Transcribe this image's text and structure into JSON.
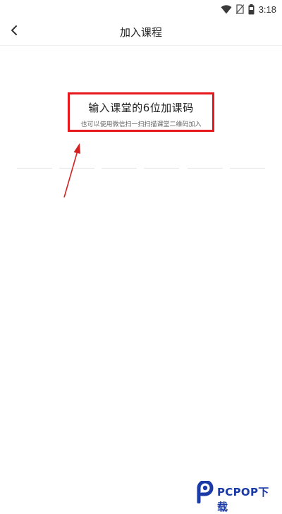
{
  "status_bar": {
    "time": "3:18",
    "icons": [
      "wifi-icon",
      "no-sim-icon",
      "battery-icon"
    ]
  },
  "header": {
    "back_icon": "chevron-left-icon",
    "title": "加入课程"
  },
  "join": {
    "title": "输入课堂的6位加课码",
    "hint": "也可以使用微信扫一扫扫描课堂二维码加入",
    "code_length": 6,
    "code_values": [
      "",
      "",
      "",
      "",
      "",
      ""
    ]
  },
  "watermark": {
    "text": "PCPOP下载"
  },
  "colors": {
    "highlight": "#e8161d",
    "arrow": "#d42020",
    "watermark": "#1a3aa8"
  }
}
